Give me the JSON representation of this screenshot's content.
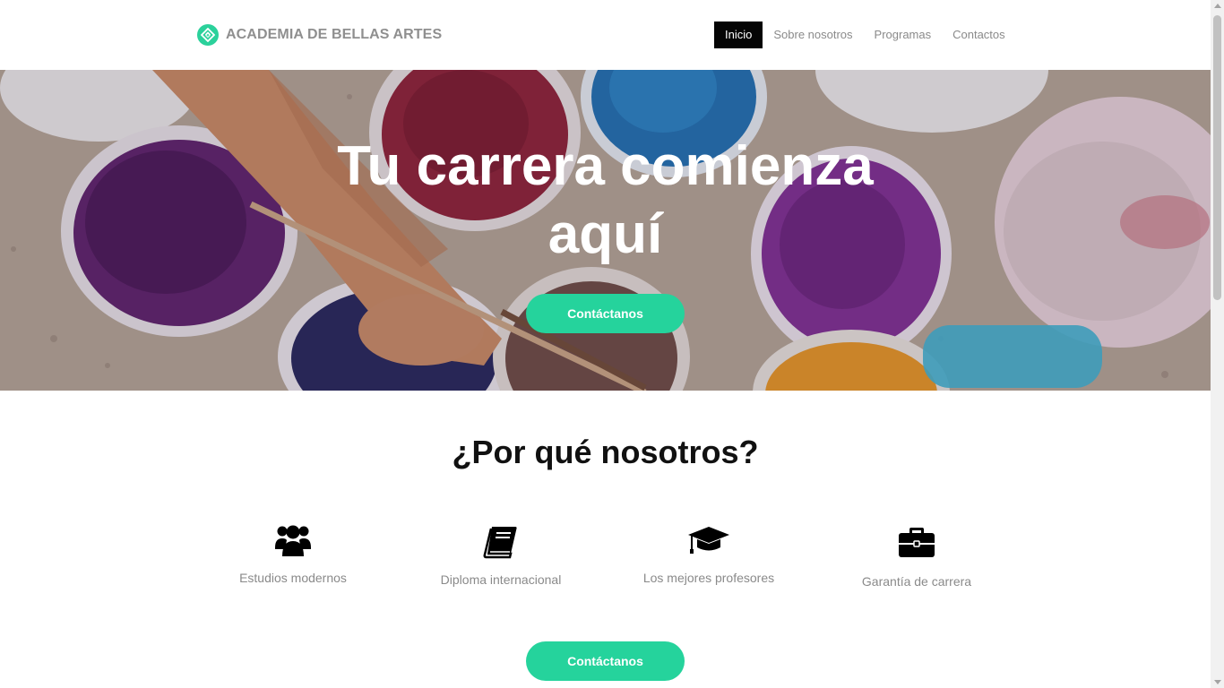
{
  "header": {
    "brand_name": "ACADEMIA DE BELLAS ARTES",
    "logo_icon": "diamond-link-icon",
    "nav": [
      "Inicio",
      "Sobre nosotros",
      "Programas",
      "Contactos"
    ],
    "active_nav": "Inicio"
  },
  "hero": {
    "title_line1": "Tu carrera comienza",
    "title_line2": "aquí",
    "cta_label": "Contáctanos",
    "background": "paint-buckets-photo"
  },
  "why": {
    "title": "¿Por qué nosotros?",
    "features": [
      {
        "icon": "users-icon",
        "label": "Estudios modernos"
      },
      {
        "icon": "book-icon",
        "label": "Diploma internacional"
      },
      {
        "icon": "graduation-cap-icon",
        "label": "Los mejores profesores"
      },
      {
        "icon": "briefcase-icon",
        "label": "Garantía de carrera"
      }
    ],
    "cta_label": "Contáctanos"
  },
  "colors": {
    "accent": "#25d39c",
    "nav_active_bg": "#050505",
    "muted_text": "#8a8a8a"
  }
}
